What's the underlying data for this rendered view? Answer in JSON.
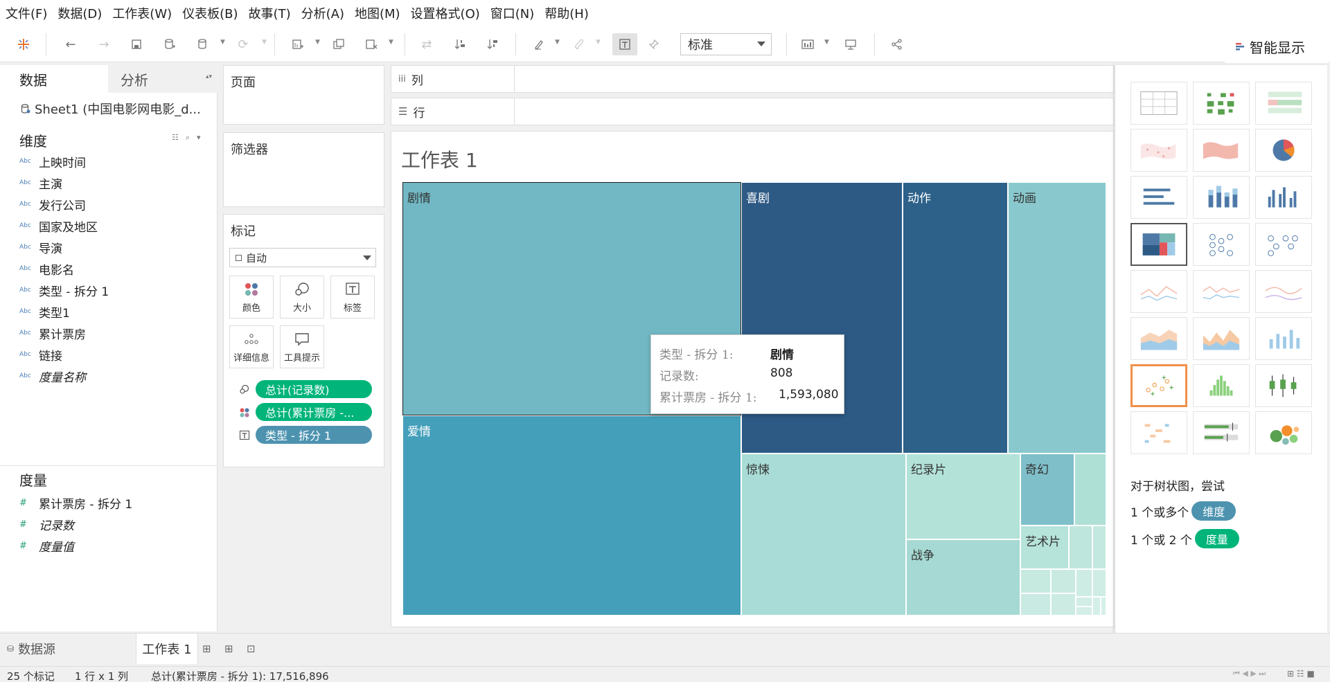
{
  "menu": [
    "文件(F)",
    "数据(D)",
    "工作表(W)",
    "仪表板(B)",
    "故事(T)",
    "分析(A)",
    "地图(M)",
    "设置格式(O)",
    "窗口(N)",
    "帮助(H)"
  ],
  "toolbar": {
    "fit_value": "标准",
    "showme_label": "智能显示"
  },
  "data_pane": {
    "tab_data": "数据",
    "tab_analysis": "分析",
    "datasource": "Sheet1 (中国电影网电影_d...",
    "dimensions_title": "维度",
    "dimensions": [
      "上映时间",
      "主演",
      "发行公司",
      "国家及地区",
      "导演",
      "电影名",
      "类型 - 拆分 1",
      "类型1",
      "累计票房",
      "链接",
      "度量名称"
    ],
    "dimension_type_label": "Abc",
    "measures_title": "度量",
    "measures": [
      "累计票房 - 拆分 1",
      "记录数",
      "度量值"
    ],
    "measure_type_label": "#"
  },
  "pages": {
    "title": "页面"
  },
  "filters": {
    "title": "筛选器"
  },
  "marks": {
    "title": "标记",
    "type": "自动",
    "buttons": {
      "color": "颜色",
      "size": "大小",
      "label": "标签",
      "detail": "详细信息",
      "tooltip": "工具提示"
    },
    "pills": [
      "总计(记录数)",
      "总计(累计票房 -...",
      "类型 - 拆分 1"
    ]
  },
  "shelves": {
    "columns": "列",
    "rows": "行"
  },
  "view": {
    "sheet_title": "工作表 1",
    "tiles": [
      {
        "label": "剧情",
        "color": "#72b8c4"
      },
      {
        "label": "爱情",
        "color": "#439fba"
      },
      {
        "label": "喜剧",
        "color": "#2d5a85"
      },
      {
        "label": "动作",
        "color": "#2d6189"
      },
      {
        "label": "动画",
        "color": "#89c9cd"
      },
      {
        "label": "惊悚",
        "color": "#a9dcd6"
      },
      {
        "label": "纪录片",
        "color": "#b3e2d9"
      },
      {
        "label": "战争",
        "color": "#a6d9d3"
      },
      {
        "label": "奇幻",
        "color": "#7fbfca"
      },
      {
        "label": "艺术片",
        "color": "#b6e3da"
      }
    ],
    "tooltip": {
      "k1": "类型 - 拆分 1:",
      "v1": "剧情",
      "k2": "记录数:",
      "v2": "808",
      "k3": "累计票房 - 拆分 1:",
      "v3": "1,593,080"
    }
  },
  "showme": {
    "hint": "对于树状图，尝试",
    "req1_prefix": "1 个或多个",
    "req1_badge": "维度",
    "req2_prefix": "1 个或 2 个",
    "req2_badge": "度量"
  },
  "bottom_tabs": {
    "datasource": "数据源",
    "sheet": "工作表 1"
  },
  "status": {
    "marks": "25 个标记",
    "rows_cols": "1 行 x 1 列",
    "sum": "总计(累计票房 - 拆分 1): 17,516,896"
  }
}
